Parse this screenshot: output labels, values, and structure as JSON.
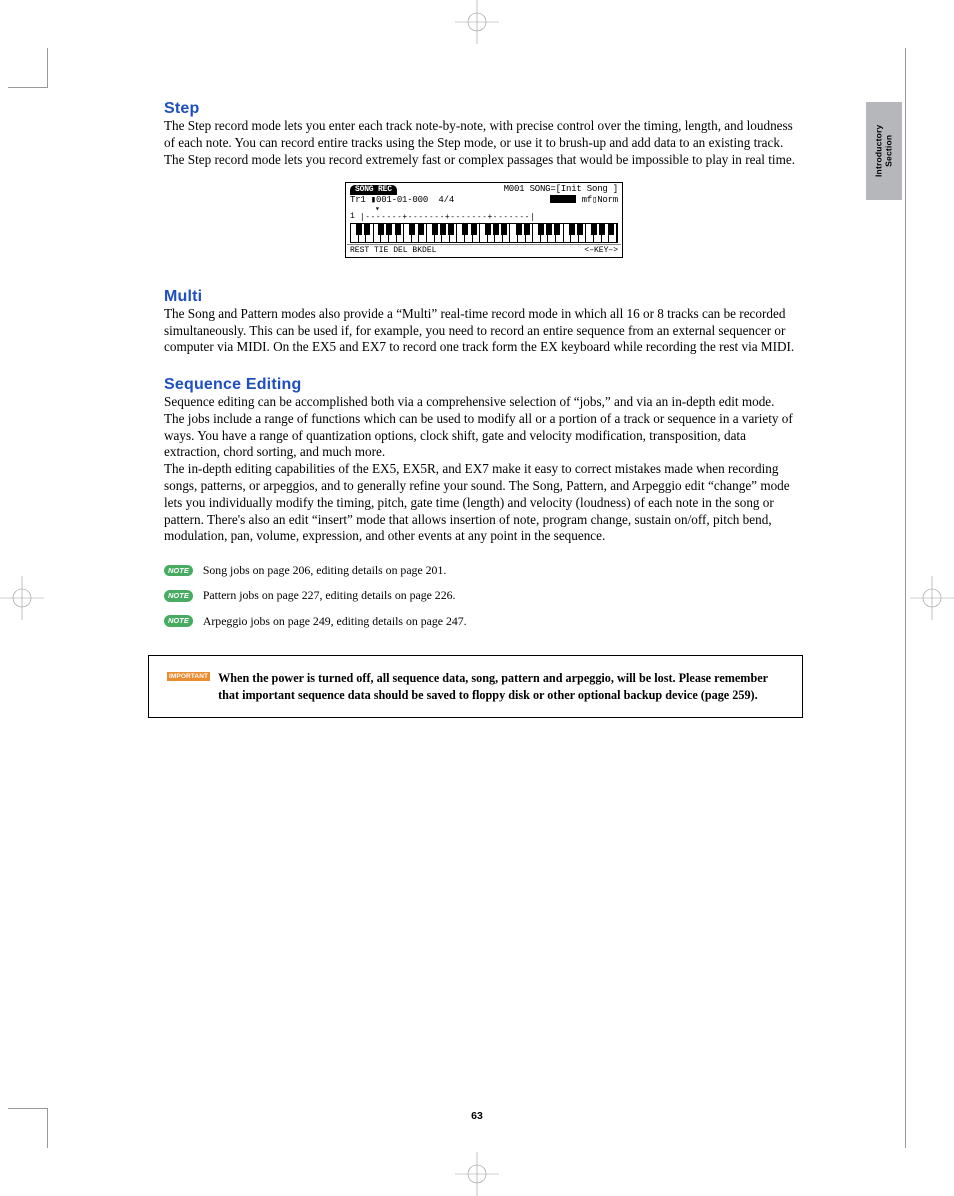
{
  "side_tab": "Introductory\nSection",
  "sections": {
    "step": {
      "heading": "Step",
      "body": "The Step record mode lets you enter each track note-by-note, with precise control over the timing, length, and loudness of each note. You can record entire tracks using the Step mode, or use it to brush-up and add data to an existing track. The Step record mode lets you record extremely fast or complex passages that would be impossible to play in real time."
    },
    "multi": {
      "heading": "Multi",
      "body": "The Song and Pattern modes also provide a “Multi” real-time record mode in which all 16 or 8 tracks can be recorded simultaneously. This can be used if, for example, you need to record an entire sequence from an external sequencer or computer via MIDI. On the EX5 and EX7 to record one track form the EX keyboard while recording the rest via MIDI."
    },
    "seqedit": {
      "heading": "Sequence Editing",
      "p1": "Sequence editing can be accomplished both via a comprehensive selection of “jobs,” and via an in-depth edit mode.",
      "p2": "The jobs include a range of functions which can be used to modify all or a portion of a track or sequence in a variety of ways. You have a range of quantization options, clock shift, gate and velocity modification, transposition, data extraction, chord sorting, and much more.",
      "p3": "The in-depth editing capabilities of the EX5, EX5R, and EX7 make it easy to correct mistakes made when recording songs, patterns, or arpeggios, and to generally refine your sound. The Song, Pattern, and Arpeggio edit “change” mode lets you individually modify the timing, pitch, gate time (length) and velocity (loudness) of each note in the song or pattern. There's also an edit “insert” mode that allows insertion of note, program change, sustain on/off, pitch bend, modulation, pan, volume, expression, and other events at any point in the sequence."
    }
  },
  "notes": {
    "badge": "NOTE",
    "n1": "Song jobs on page 206, editing details on page 201.",
    "n2": "Pattern jobs on page 227, editing details on page 226.",
    "n3": "Arpeggio jobs on page 249, editing details on page 247."
  },
  "important": {
    "badge": "IMPORTANT",
    "text": "When the power is turned off, all sequence data, song, pattern and arpeggio, will be lost. Please remember that important sequence data should be saved to floppy disk or other optional backup device (page 259)."
  },
  "lcd": {
    "tab": "SONG REC",
    "top_right": "M001 SONG=[Init Song ]",
    "line2_left": "Tr1 ▮001-01-000  4/4",
    "line2_right": " mf▯Norm",
    "meas_num": "1",
    "meas_line": "|-------+-------+-------+-------|",
    "bottom_left": "REST TIE DEL BKDEL",
    "bottom_right": "<–KEY–>"
  },
  "page_number": "63"
}
